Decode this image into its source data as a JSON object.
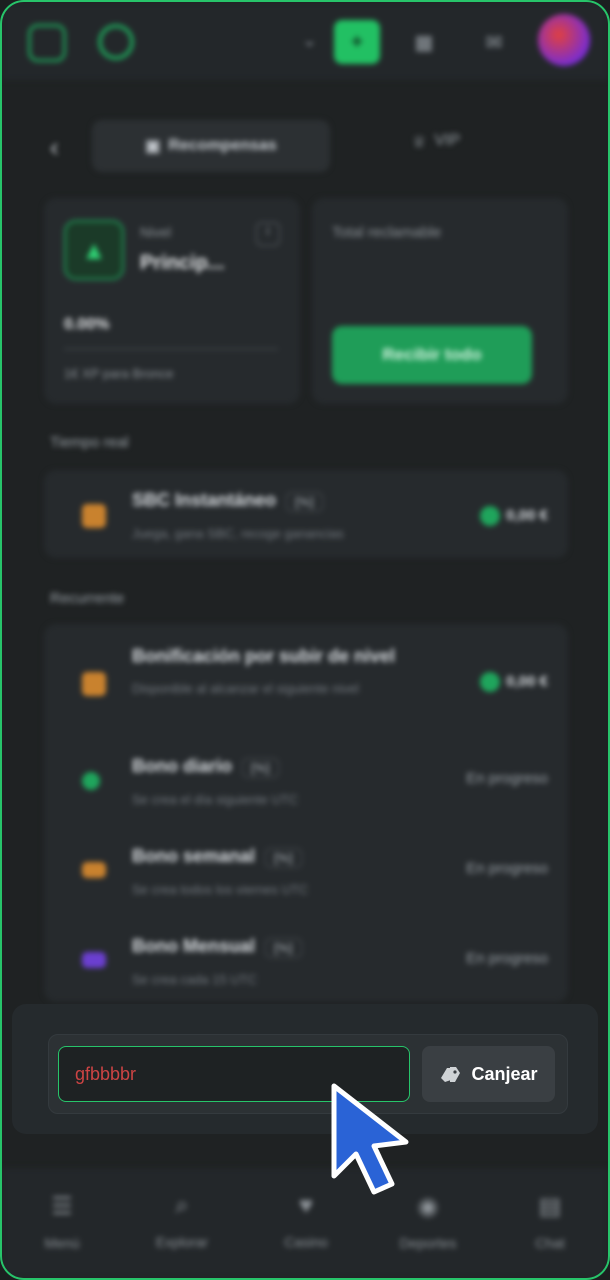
{
  "header": {
    "logo_icon": "brand-logo-icon",
    "chevron_icon": "chevron-down-icon",
    "deposit_glyph": "+",
    "icons": [
      "gift-icon",
      "bell-icon"
    ]
  },
  "tabs": {
    "back_glyph": "‹",
    "rewards_label": "Recompensas",
    "vip_label": "VIP"
  },
  "level_card": {
    "level_label": "Nivel",
    "level_name": "Princip...",
    "progress": "0.00%",
    "progress_value": 0,
    "next_text": "1€ XP para Bronce",
    "info_glyph": "i"
  },
  "claim_card": {
    "total_label": "Total reclamable",
    "claim_button": "Recibir todo"
  },
  "realtime": {
    "section_title": "Tiempo real",
    "item": {
      "title": "SBC Instantáneo",
      "badge": "[%]",
      "subtitle": "Juega, gana SBC, recoge ganancias",
      "amount": "0,00 €"
    }
  },
  "recurring": {
    "section_title": "Recurrente",
    "items": [
      {
        "title": "Bonificación por subir de nivel",
        "badge": "",
        "subtitle": "Disponible al alcanzar el siguiente nivel",
        "right": "0,00 €",
        "icon_color": "#c9822e"
      },
      {
        "title": "Bono diario",
        "badge": "[%]",
        "subtitle": "Se crea el día siguiente UTC",
        "right": "En progreso",
        "icon_color": "#1fa55c"
      },
      {
        "title": "Bono semanal",
        "badge": "[%]",
        "subtitle": "Se crea todos los viernes UTC",
        "right": "En progreso",
        "icon_color": "#c9822e"
      },
      {
        "title": "Bono Mensual",
        "badge": "[%]",
        "subtitle": "Se crea cada 15 UTC",
        "right": "En progreso",
        "icon_color": "#6b3fd0"
      }
    ]
  },
  "redeem": {
    "code_value": "gfbbbbr",
    "button_label": "Canjear"
  },
  "bottom_nav": [
    {
      "label": "Menú",
      "icon": "menu-icon"
    },
    {
      "label": "Explorar",
      "icon": "search-icon"
    },
    {
      "label": "Casino",
      "icon": "casino-icon"
    },
    {
      "label": "Deportes",
      "icon": "sports-icon"
    },
    {
      "label": "Chat",
      "icon": "chat-icon"
    }
  ],
  "colors": {
    "accent": "#27c46a",
    "background": "#1f2223",
    "cursor": "#2a63d6"
  }
}
